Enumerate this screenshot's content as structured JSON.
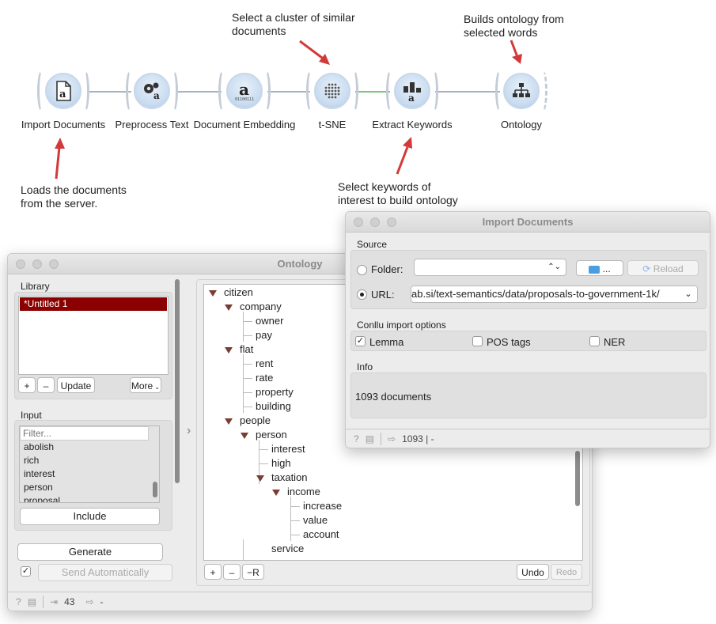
{
  "workflow": {
    "nodes": [
      {
        "label": "Import Documents",
        "icon": "document-icon"
      },
      {
        "label": "Preprocess Text",
        "icon": "gears-icon"
      },
      {
        "label": "Document Embedding",
        "icon": "embedding-icon"
      },
      {
        "label": "t-SNE",
        "icon": "tsne-icon"
      },
      {
        "label": "Extract Keywords",
        "icon": "keywords-icon"
      },
      {
        "label": "Ontology",
        "icon": "ontology-icon"
      }
    ],
    "notes": {
      "tsne": [
        "Select a cluster of similar",
        "documents"
      ],
      "ontology": [
        "Builds ontology from",
        "selected words"
      ],
      "import": [
        "Loads the documents",
        "from the server."
      ],
      "keywords": [
        "Select keywords of",
        "interest to build ontology"
      ]
    },
    "colors": {
      "arrow": "#d23a3a",
      "active_link": "#7bc67b",
      "link": "#a9b2bd"
    }
  },
  "ontology_window": {
    "title": "Ontology",
    "library": {
      "label": "Library",
      "items": [
        "*Untitled 1"
      ],
      "add": "+",
      "remove": "–",
      "update": "Update",
      "more": "More"
    },
    "input": {
      "label": "Input",
      "filter_placeholder": "Filter...",
      "words": [
        "abolish",
        "rich",
        "interest",
        "person",
        "proposal"
      ],
      "include": "Include"
    },
    "generate": "Generate",
    "send_automatically": "Send Automatically",
    "tree": {
      "citizen": "citizen",
      "company": "company",
      "owner": "owner",
      "pay": "pay",
      "flat": "flat",
      "rent": "rent",
      "rate": "rate",
      "property": "property",
      "building": "building",
      "people": "people",
      "person": "person",
      "interest": "interest",
      "high": "high",
      "taxation": "taxation",
      "income": "income",
      "increase": "increase",
      "value": "value",
      "account": "account",
      "service": "service"
    },
    "tree_buttons": {
      "add": "+",
      "remove": "–",
      "remove_all": "−R",
      "undo": "Undo",
      "redo": "Redo"
    },
    "status": {
      "input_count": "43",
      "output": "-"
    },
    "colors": {
      "selected": "#8b0000",
      "tree_arrow": "#7a3c33"
    }
  },
  "import_window": {
    "title": "Import Documents",
    "source_label": "Source",
    "folder_label": "Folder:",
    "folder_button": "...",
    "reload": "Reload",
    "url_label": "URL:",
    "url_value": "ab.si/text-semantics/data/proposals-to-government-1k/",
    "conllu_label": "Conllu import options",
    "options": {
      "lemma": "Lemma",
      "pos": "POS tags",
      "ner": "NER"
    },
    "info_label": "Info",
    "info_text": "1093 documents",
    "status": "1093 | -"
  }
}
